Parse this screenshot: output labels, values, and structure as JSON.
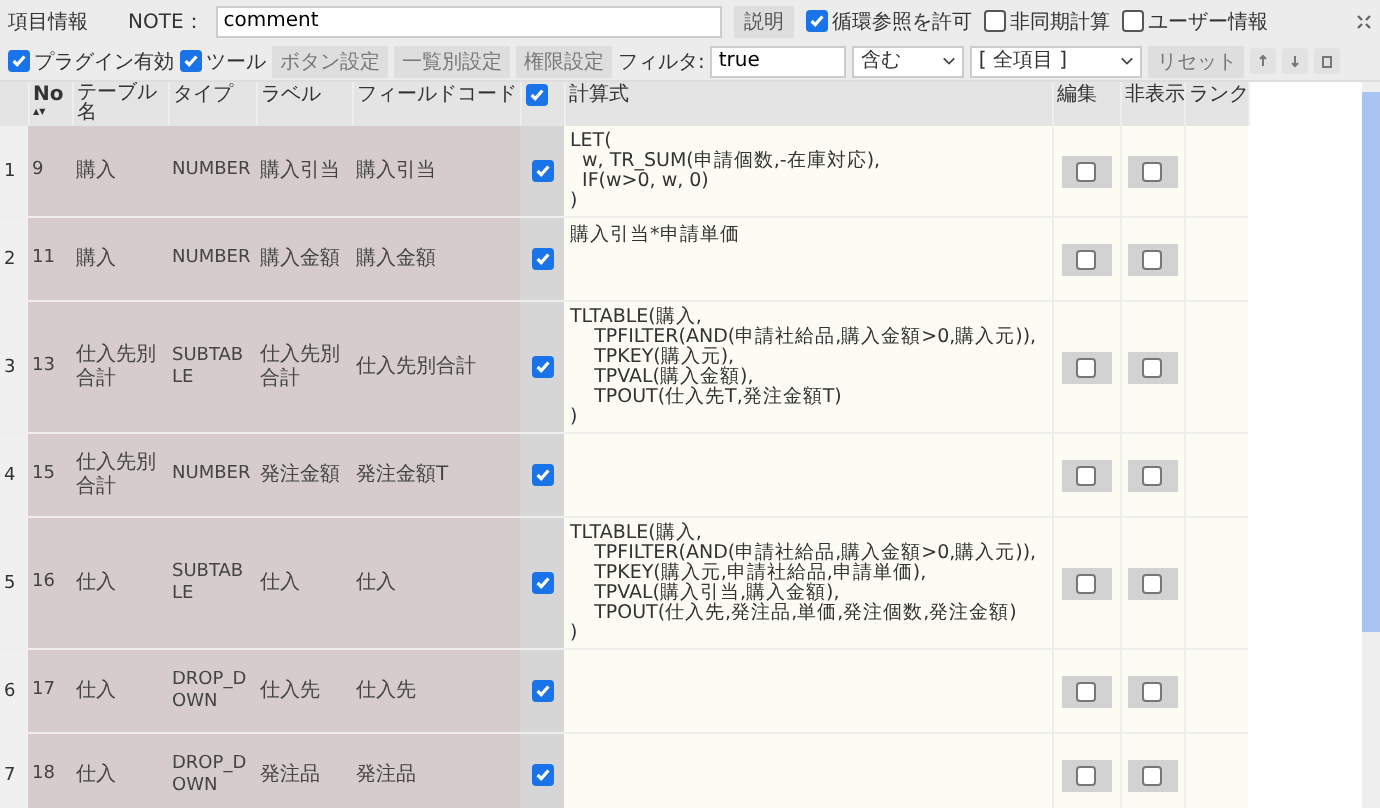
{
  "toolbar": {
    "title": "項目情報",
    "note_label": "NOTE：",
    "note": {
      "value": "comment"
    },
    "help_button": "説明",
    "options": [
      {
        "label": "循環参照を許可",
        "checked": true
      },
      {
        "label": "非同期計算",
        "checked": false
      },
      {
        "label": "ユーザー情報",
        "checked": false
      }
    ]
  },
  "toolbar2": {
    "toggles": [
      {
        "label": "プラグイン有効",
        "checked": true
      },
      {
        "label": "ツール",
        "checked": true
      }
    ],
    "buttons": [
      "ボタン設定",
      "一覧別設定",
      "権限設定"
    ],
    "filter_label": "フィルタ:",
    "filter": {
      "value": "true"
    },
    "match": "含む",
    "scope": "[ 全項目 ]",
    "reset": "リセット"
  },
  "table": {
    "columns": [
      "No",
      "テーブル名",
      "タイプ",
      "ラベル",
      "フィールドコード",
      "計算式",
      "編集",
      "非表示",
      "ランク"
    ],
    "sort_mark": "▲▼",
    "all_checked": true,
    "rows": [
      {
        "index": "1",
        "no": "9",
        "table": "購入",
        "type": "NUMBER",
        "label": "購入引当",
        "code": "購入引当",
        "checked": true,
        "formula": "LET(\n  w, TR_SUM(申請個数,-在庫対応),\n  IF(w>0, w, 0)\n)",
        "edit": false,
        "hidden": false
      },
      {
        "index": "2",
        "no": "11",
        "table": "購入",
        "type": "NUMBER",
        "label": "購入金額",
        "code": "購入金額",
        "checked": true,
        "formula": "購入引当*申請単価",
        "edit": false,
        "hidden": false
      },
      {
        "index": "3",
        "no": "13",
        "table": "仕入先別合計",
        "type": "SUBTABLE",
        "label": "仕入先別合計",
        "code": "仕入先別合計",
        "checked": true,
        "formula": "TLTABLE(購入,\n    TPFILTER(AND(申請社給品,購入金額>0,購入元)),\n    TPKEY(購入元),\n    TPVAL(購入金額),\n    TPOUT(仕入先T,発注金額T)\n)",
        "edit": false,
        "hidden": false
      },
      {
        "index": "4",
        "no": "15",
        "table": "仕入先別合計",
        "type": "NUMBER",
        "label": "発注金額",
        "code": "発注金額T",
        "checked": true,
        "formula": "",
        "edit": false,
        "hidden": false
      },
      {
        "index": "5",
        "no": "16",
        "table": "仕入",
        "type": "SUBTABLE",
        "label": "仕入",
        "code": "仕入",
        "checked": true,
        "formula": "TLTABLE(購入,\n    TPFILTER(AND(申請社給品,購入金額>0,購入元)),\n    TPKEY(購入元,申請社給品,申請単価),\n    TPVAL(購入引当,購入金額),\n    TPOUT(仕入先,発注品,単価,発注個数,発注金額)\n)",
        "edit": false,
        "hidden": false
      },
      {
        "index": "6",
        "no": "17",
        "table": "仕入",
        "type": "DROP_DOWN",
        "label": "仕入先",
        "code": "仕入先",
        "checked": true,
        "formula": "",
        "edit": false,
        "hidden": false
      },
      {
        "index": "7",
        "no": "18",
        "table": "仕入",
        "type": "DROP_DOWN",
        "label": "発注品",
        "code": "発注品",
        "checked": true,
        "formula": "",
        "edit": false,
        "hidden": false
      }
    ]
  }
}
